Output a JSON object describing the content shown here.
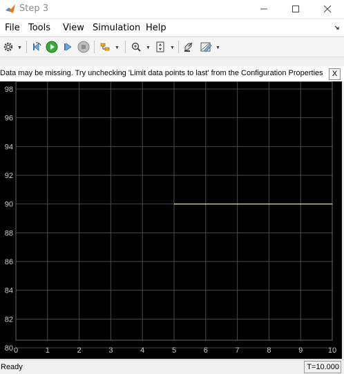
{
  "window": {
    "title": "Step 3"
  },
  "menu": {
    "items": [
      "File",
      "Tools",
      "View",
      "Simulation",
      "Help"
    ]
  },
  "toolbar": {
    "icons": [
      "gear-icon",
      "step-back-icon",
      "run-icon",
      "step-forward-icon",
      "stop-icon",
      "signal-select-icon",
      "zoom-icon",
      "scale-axes-icon",
      "highlight-block-icon",
      "style-pen-icon"
    ]
  },
  "banner": {
    "text": "Data may be missing.  Try unchecking 'Limit data points to last' from the Configuration Properties",
    "close_label": "X"
  },
  "status": {
    "ready": "Ready",
    "time": "T=10.000"
  },
  "colors": {
    "signal": "#ffff66",
    "plot_bg": "#000000",
    "grid": "#4a4a4a",
    "tick": "#cccccc"
  },
  "chart_data": {
    "type": "line",
    "title": "",
    "xlabel": "",
    "ylabel": "",
    "xlim": [
      0,
      10
    ],
    "ylim": [
      80,
      98
    ],
    "xticks": [
      0,
      1,
      2,
      3,
      4,
      5,
      6,
      7,
      8,
      9,
      10
    ],
    "yticks": [
      80,
      82,
      84,
      86,
      88,
      90,
      92,
      94,
      96,
      98
    ],
    "grid": true,
    "series": [
      {
        "x": [
          5,
          10
        ],
        "y": [
          90,
          90
        ]
      }
    ]
  }
}
